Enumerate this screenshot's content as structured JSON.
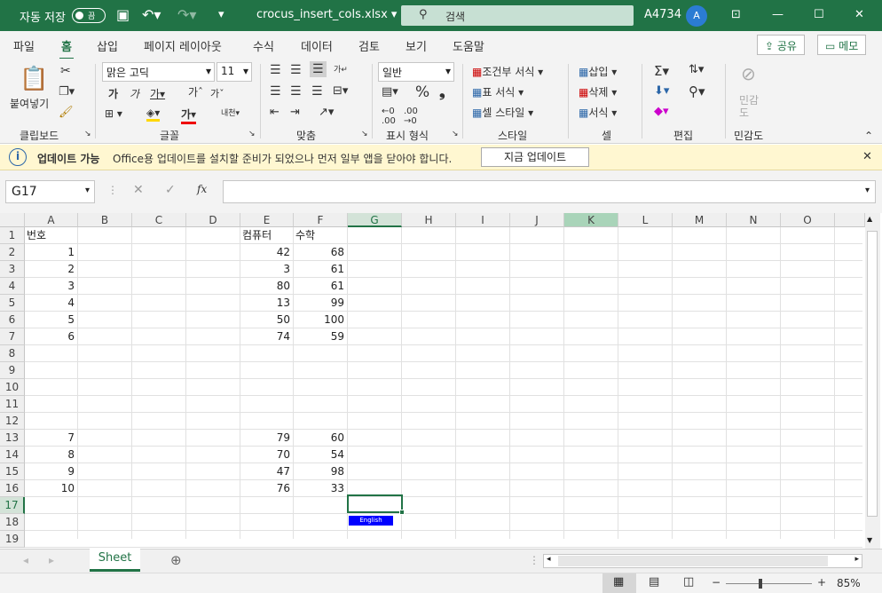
{
  "titlebar": {
    "autosave": "자동 저장",
    "toggle": "끔",
    "filename": "crocus_insert_cols.xlsx",
    "search_placeholder": "검색",
    "user": "A4734",
    "avatar": "A"
  },
  "menu": [
    "파일",
    "홈",
    "삽입",
    "페이지 레이아웃",
    "수식",
    "데이터",
    "검토",
    "보기",
    "도움말"
  ],
  "menu_active": "홈",
  "share_label": "공유",
  "memo_label": "메모",
  "ribbon": {
    "clipboard": {
      "paste": "붙여넣기",
      "label": "클립보드"
    },
    "font": {
      "name": "맑은 고딕",
      "size": "11",
      "label": "글꼴"
    },
    "align": {
      "label": "맞춤"
    },
    "number": {
      "format": "일반",
      "label": "표시 형식"
    },
    "style": {
      "conditional": "조건부 서식",
      "table": "표 서식",
      "cell": "셀 스타일",
      "label": "스타일"
    },
    "cells": {
      "insert": "삽입",
      "delete": "삭제",
      "format": "서식",
      "label": "셀"
    },
    "editing": {
      "label": "편집"
    },
    "sensitivity": {
      "btn": "민감도",
      "label": "민감도"
    }
  },
  "infobar": {
    "title": "업데이트 가능",
    "message": "Office용 업데이트를 설치할 준비가 되었으나 먼저 일부 앱을 닫아야 합니다.",
    "button": "지금 업데이트"
  },
  "namebox": "G17",
  "columns": [
    "A",
    "B",
    "C",
    "D",
    "E",
    "F",
    "G",
    "H",
    "I",
    "J",
    "K",
    "L",
    "M",
    "N",
    "O"
  ],
  "rows": [
    {
      "n": "1",
      "A": "번호",
      "E": "컴퓨터",
      "F": "수학"
    },
    {
      "n": "2",
      "A": "1",
      "E": "42",
      "F": "68"
    },
    {
      "n": "3",
      "A": "2",
      "E": "3",
      "F": "61"
    },
    {
      "n": "4",
      "A": "3",
      "E": "80",
      "F": "61"
    },
    {
      "n": "5",
      "A": "4",
      "E": "13",
      "F": "99"
    },
    {
      "n": "6",
      "A": "5",
      "E": "50",
      "F": "100"
    },
    {
      "n": "7",
      "A": "6",
      "E": "74",
      "F": "59"
    },
    {
      "n": "8"
    },
    {
      "n": "9"
    },
    {
      "n": "10"
    },
    {
      "n": "11"
    },
    {
      "n": "12"
    },
    {
      "n": "13",
      "A": "7",
      "E": "79",
      "F": "60"
    },
    {
      "n": "14",
      "A": "8",
      "E": "70",
      "F": "54"
    },
    {
      "n": "15",
      "A": "9",
      "E": "47",
      "F": "98"
    },
    {
      "n": "16",
      "A": "10",
      "E": "76",
      "F": "33"
    },
    {
      "n": "17"
    },
    {
      "n": "18"
    },
    {
      "n": "19"
    }
  ],
  "english_label": "English",
  "sheet_tab": "Sheet",
  "zoom": "85%"
}
